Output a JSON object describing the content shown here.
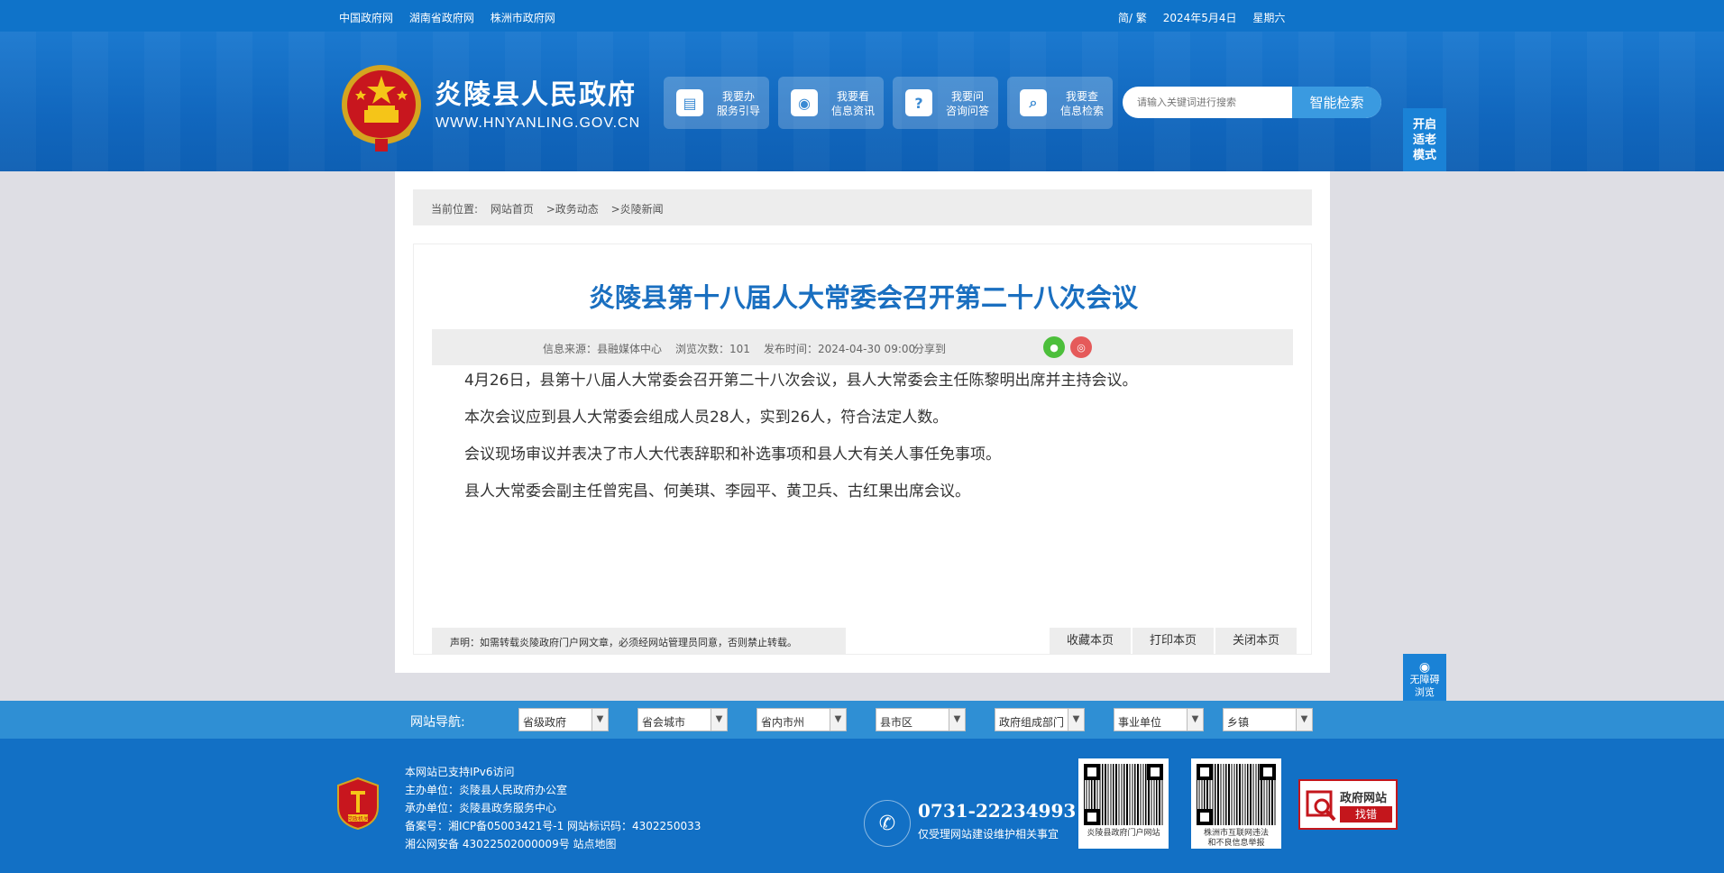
{
  "topbar": {
    "links": [
      "中国政府网",
      "湖南省政府网",
      "株洲市政府网"
    ],
    "lang": "简/ 繁",
    "date": "2024年5月4日",
    "weekday": "星期六"
  },
  "header": {
    "site_name": "炎陵县人民政府",
    "site_url": "WWW.HNYANLING.GOV.CN",
    "services": [
      {
        "line1": "我要办",
        "line2": "服务引导",
        "icon": "document-icon"
      },
      {
        "line1": "我要看",
        "line2": "信息资讯",
        "icon": "eye-icon"
      },
      {
        "line1": "我要问",
        "line2": "咨询问答",
        "icon": "question-icon"
      },
      {
        "line1": "我要查",
        "line2": "信息检索",
        "icon": "search-icon"
      }
    ],
    "search_placeholder": "请输入关键词进行搜索",
    "search_button": "智能检索",
    "elder_mode": [
      "开启",
      "适老",
      "模式"
    ]
  },
  "breadcrumb": {
    "label": "当前位置:",
    "items": [
      "网站首页",
      ">政务动态",
      ">炎陵新闻"
    ]
  },
  "article": {
    "title": "炎陵县第十八届人大常委会召开第二十八次会议",
    "source": "信息来源：县融媒体中心",
    "views": "浏览次数：101",
    "published": "发布时间：2024-04-30 09:00",
    "share_label": "分享到",
    "paragraphs": [
      "4月26日，县第十八届人大常委会召开第二十八次会议，县人大常委会主任陈黎明出席并主持会议。",
      "本次会议应到县人大常委会组成人员28人，实到26人，符合法定人数。",
      "会议现场审议并表决了市人大代表辞职和补选事项和县人大有关人事任免事项。",
      "县人大常委会副主任曾宪昌、何美琪、李园平、黄卫兵、古红果出席会议。"
    ],
    "notice": "声明：如需转载炎陵政府门户网文章，必须经网站管理员同意，否则禁止转载。",
    "actions": [
      "收藏本页",
      "打印本页",
      "关闭本页"
    ]
  },
  "accessibility": [
    "无障碍",
    "浏览"
  ],
  "nav": {
    "label": "网站导航:",
    "selects": [
      "省级政府",
      "省会城市",
      "省内市州",
      "县市区",
      "政府组成部门",
      "事业单位",
      "乡镇"
    ]
  },
  "footer": {
    "badge_text": "党政机关",
    "lines": [
      "本网站已支持IPv6访问",
      "主办单位：炎陵县人民政府办公室",
      "承办单位：炎陵县政务服务中心",
      "备案号：湘ICP备05003421号-1 网站标识码：4302250033",
      "湘公网安备 43022502000009号 站点地图"
    ],
    "phone": "0731-22234993",
    "phone_note": "仅受理网站建设维护相关事宜",
    "qr1_caption": "炎陵县政府门户网站",
    "qr2_caption": [
      "株洲市互联网违法",
      "和不良信息举报"
    ],
    "gov_error_line1": "政府网站",
    "gov_error_line2": "找错"
  },
  "colors": {
    "primary": "#0f73c9",
    "title": "#1a6fc0",
    "error_red": "#c4161c"
  }
}
